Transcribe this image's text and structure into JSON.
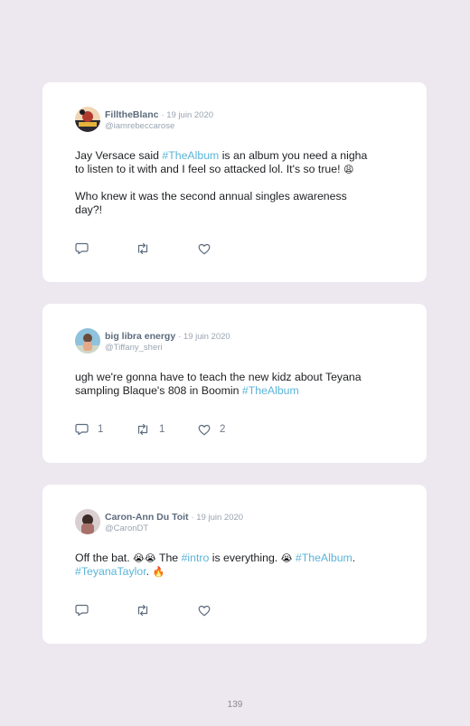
{
  "page_number": "139",
  "tweets": [
    {
      "name": "FilltheBlanc",
      "date": "· 19 juin 2020",
      "handle": "@iamrebeccarose",
      "paragraphs": [
        [
          "Jay Versace said ",
          "#TheAlbum",
          " is an album you need a nigha",
          "to listen to it with and I feel so attacked lol. It's so true! ",
          "😩"
        ],
        [
          "Who knew it was the second annual singles awareness",
          "day?!"
        ]
      ],
      "replies": "",
      "retweets": "",
      "likes": ""
    },
    {
      "name": "big libra energy",
      "date": "· 19 juin 2020",
      "handle": "@Tiffany_sheri",
      "paragraphs": [
        [
          "ugh we're gonna have to teach the new kidz about Teyana",
          "sampling Blaque's 808 in Boomin ",
          "#TheAlbum"
        ]
      ],
      "replies": "1",
      "retweets": "1",
      "likes": "2"
    },
    {
      "name": "Caron-Ann Du Toit",
      "date": "· 19 juin 2020",
      "handle": "@CaronDT",
      "paragraphs": [
        [
          "Off the bat. ",
          "😭😭",
          " The ",
          "#intro",
          " is everything. ",
          "😭",
          " ",
          "#TheAlbum",
          ".",
          "#TeyanaTaylor",
          ". ",
          "🔥"
        ]
      ],
      "replies": "",
      "retweets": "",
      "likes": ""
    }
  ]
}
